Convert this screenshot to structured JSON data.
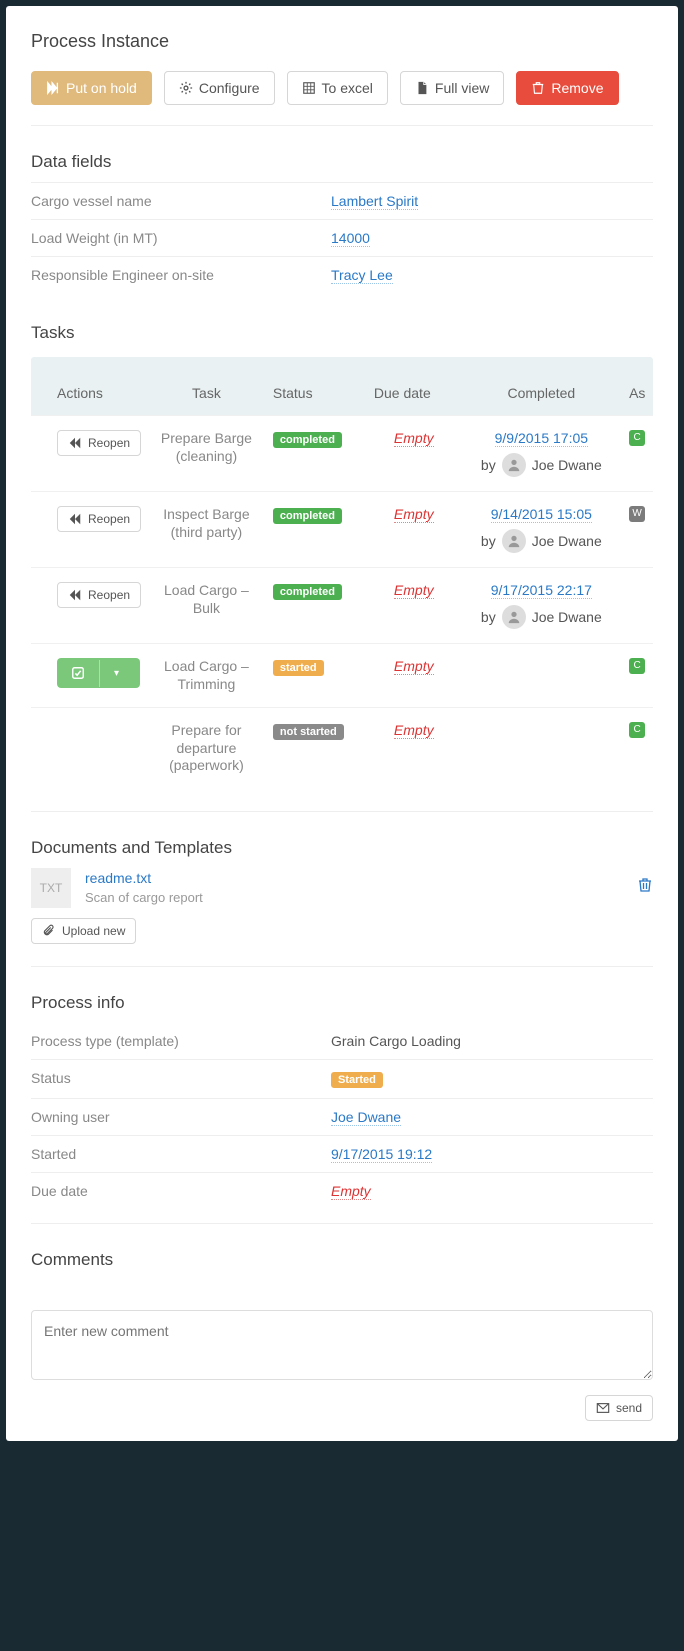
{
  "header": {
    "title": "Process Instance"
  },
  "toolbar": {
    "hold": "Put on hold",
    "configure": "Configure",
    "excel": "To excel",
    "full": "Full view",
    "remove": "Remove"
  },
  "dataFields": {
    "title": "Data fields",
    "rows": [
      {
        "label": "Cargo vessel name",
        "value": "Lambert Spirit",
        "type": "link"
      },
      {
        "label": "Load Weight (in MT)",
        "value": "14000",
        "type": "link"
      },
      {
        "label": "Responsible Engineer on-site",
        "value": "Tracy Lee",
        "type": "link"
      }
    ]
  },
  "tasks": {
    "title": "Tasks",
    "headers": {
      "actions": "Actions",
      "task": "Task",
      "status": "Status",
      "due": "Due date",
      "completed": "Completed",
      "assigned": "As"
    },
    "reopen_label": "Reopen",
    "by_label": "by",
    "rows": [
      {
        "actionType": "reopen",
        "name": "Prepare Barge (cleaning)",
        "status": "completed",
        "statusClass": "completed",
        "due": "Empty",
        "completedDate": "9/9/2015 17:05",
        "completedBy": "Joe Dwane",
        "asg": "C",
        "asgClass": "green"
      },
      {
        "actionType": "reopen",
        "name": "Inspect Barge (third party)",
        "status": "completed",
        "statusClass": "completed",
        "due": "Empty",
        "completedDate": "9/14/2015 15:05",
        "completedBy": "Joe Dwane",
        "asg": "W",
        "asgClass": ""
      },
      {
        "actionType": "reopen",
        "name": "Load Cargo – Bulk",
        "status": "completed",
        "statusClass": "completed",
        "due": "Empty",
        "completedDate": "9/17/2015 22:17",
        "completedBy": "Joe Dwane",
        "asg": "",
        "asgClass": "spacer"
      },
      {
        "actionType": "split",
        "name": "Load Cargo – Trimming",
        "status": "started",
        "statusClass": "started",
        "due": "Empty",
        "completedDate": "",
        "completedBy": "",
        "asg": "C",
        "asgClass": "green"
      },
      {
        "actionType": "none",
        "name": "Prepare for departure (paperwork)",
        "status": "not started",
        "statusClass": "notstarted",
        "due": "Empty",
        "completedDate": "",
        "completedBy": "",
        "asg": "C",
        "asgClass": "green"
      }
    ]
  },
  "documents": {
    "title": "Documents and Templates",
    "thumb": "TXT",
    "name": "readme.txt",
    "desc": "Scan of cargo report",
    "upload": "Upload new"
  },
  "processInfo": {
    "title": "Process info",
    "rows": [
      {
        "label": "Process type (template)",
        "value": "Grain Cargo Loading",
        "type": "plain"
      },
      {
        "label": "Status",
        "value": "Started",
        "type": "badge"
      },
      {
        "label": "Owning user",
        "value": "Joe Dwane",
        "type": "link"
      },
      {
        "label": "Started",
        "value": "9/17/2015 19:12",
        "type": "link"
      },
      {
        "label": "Due date",
        "value": "Empty",
        "type": "empty"
      }
    ]
  },
  "comments": {
    "title": "Comments",
    "placeholder": "Enter new comment",
    "send": "send"
  }
}
